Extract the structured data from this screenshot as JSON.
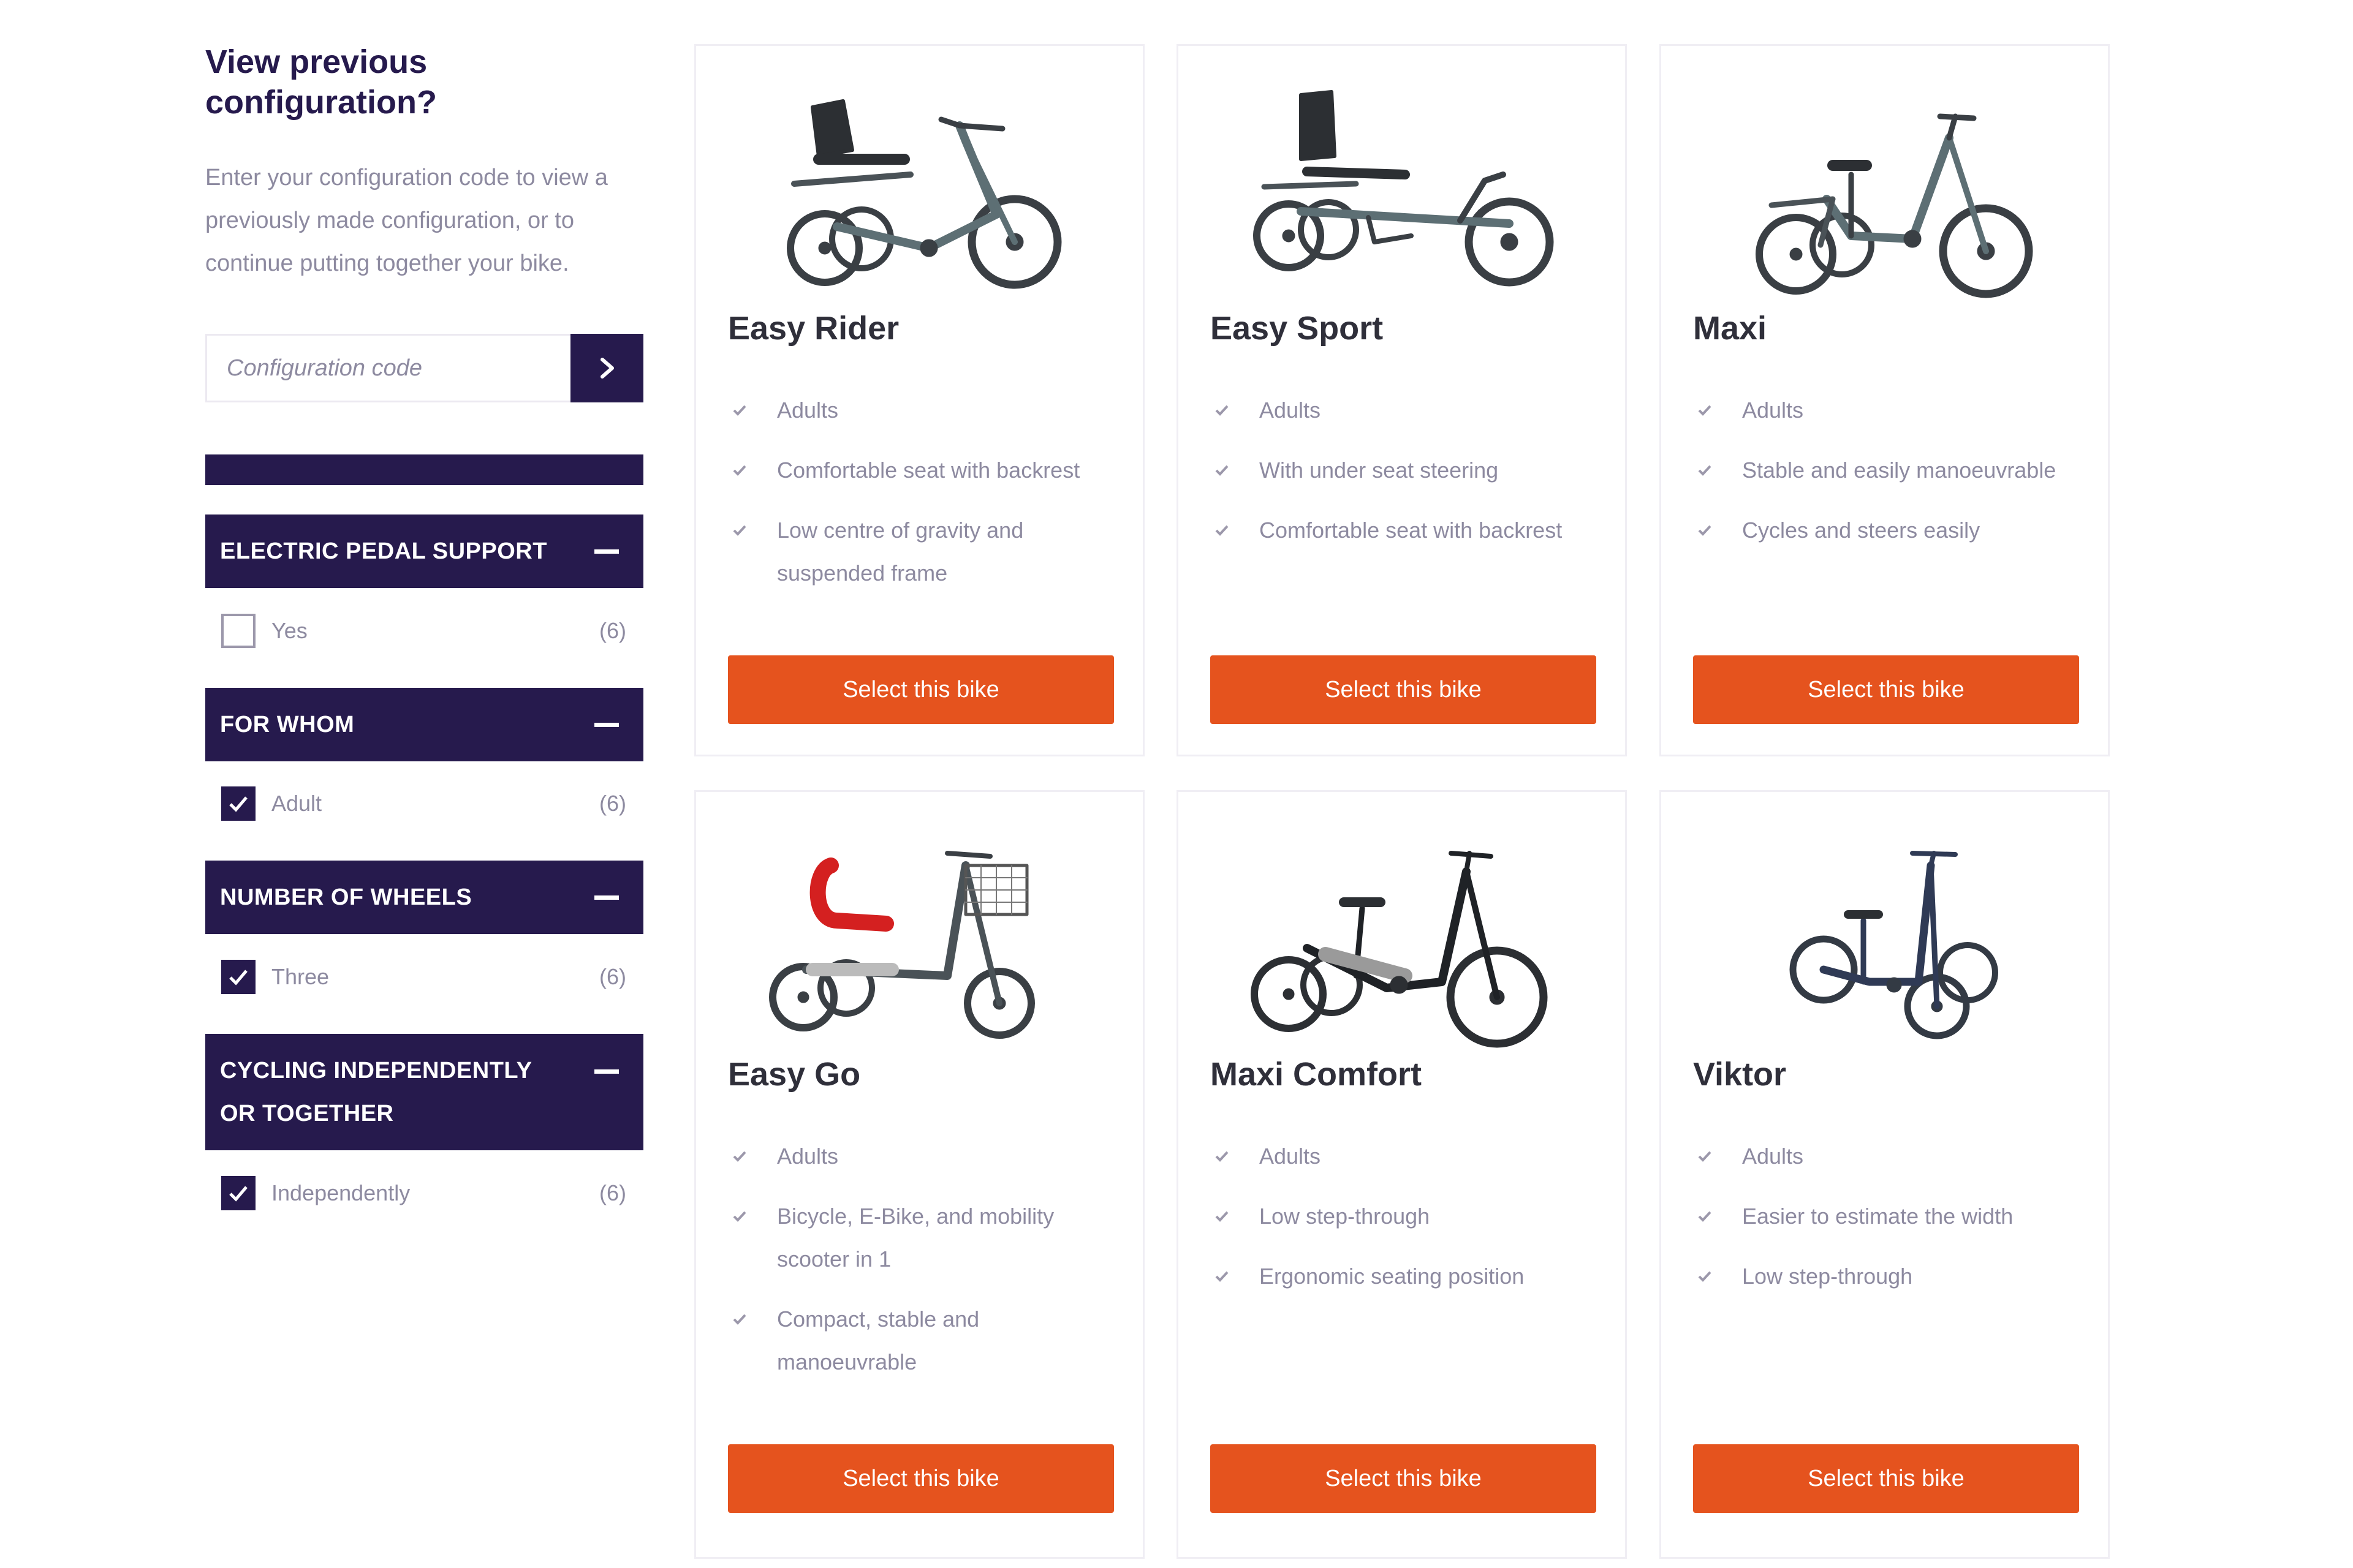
{
  "sidebar": {
    "title": "View previous configuration?",
    "description": "Enter your configuration code to view a previously made configuration, or to continue putting together your bike.",
    "config_placeholder": "Configuration code",
    "submit_icon": "chevron-right-icon",
    "filters": [
      {
        "heading": "ELECTRIC PEDAL SUPPORT",
        "options": [
          {
            "label": "Yes",
            "count": "(6)",
            "checked": false
          }
        ]
      },
      {
        "heading": "FOR WHOM",
        "options": [
          {
            "label": "Adult",
            "count": "(6)",
            "checked": true
          }
        ]
      },
      {
        "heading": "NUMBER OF WHEELS",
        "options": [
          {
            "label": "Three",
            "count": "(6)",
            "checked": true
          }
        ]
      },
      {
        "heading": "CYCLING INDEPENDENTLY OR TOGETHER",
        "options": [
          {
            "label": "Independently",
            "count": "(6)",
            "checked": true
          }
        ]
      }
    ]
  },
  "products": [
    {
      "name": "Easy Rider",
      "features": [
        "Adults",
        "Comfortable seat with backrest",
        "Low centre of gravity and suspended frame"
      ],
      "button": "Select this bike"
    },
    {
      "name": "Easy Sport",
      "features": [
        "Adults",
        "With under seat steering",
        "Comfortable seat with backrest"
      ],
      "button": "Select this bike"
    },
    {
      "name": "Maxi",
      "features": [
        "Adults",
        "Stable and easily manoeuvrable",
        "Cycles and steers easily"
      ],
      "button": "Select this bike"
    },
    {
      "name": "Easy Go",
      "features": [
        "Adults",
        "Bicycle, E-Bike, and mobility scooter in 1",
        "Compact, stable and manoeuvrable"
      ],
      "button": "Select this bike"
    },
    {
      "name": "Maxi Comfort",
      "features": [
        "Adults",
        "Low step-through",
        "Ergonomic seating position"
      ],
      "button": "Select this bike"
    },
    {
      "name": "Viktor",
      "features": [
        "Adults",
        "Easier to estimate the width",
        "Low step-through"
      ],
      "button": "Select this bike"
    }
  ],
  "colors": {
    "primary": "#261a4d",
    "accent": "#e5531e",
    "muted_text": "#8d8aa0",
    "frame": "#5d6f74",
    "seat_red": "#d42020"
  }
}
